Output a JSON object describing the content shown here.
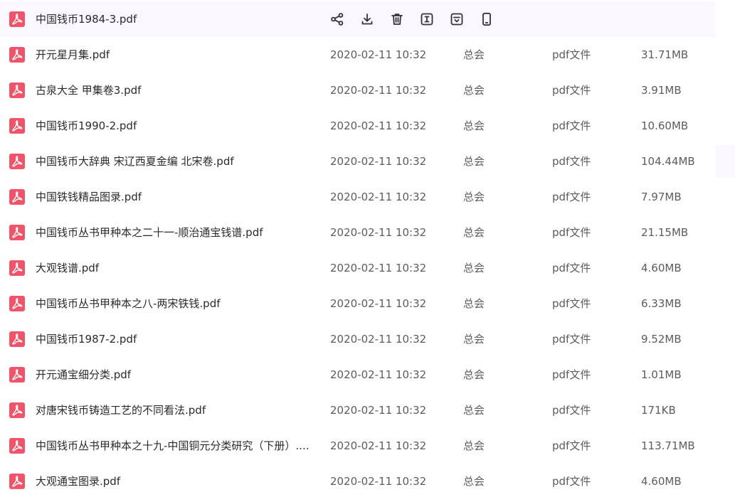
{
  "row_actions": [
    {
      "name": "share-icon",
      "label": "share"
    },
    {
      "name": "download-icon",
      "label": "download"
    },
    {
      "name": "delete-icon",
      "label": "delete"
    },
    {
      "name": "rename-icon",
      "label": "rename"
    },
    {
      "name": "move-icon",
      "label": "move"
    },
    {
      "name": "phone-icon",
      "label": "send to phone"
    }
  ],
  "colors": {
    "pdf_icon": "#f0546a",
    "hover_row": "#fbf7fe",
    "action_icon": "#333333",
    "text_primary": "#2b2b2b",
    "text_secondary": "#5c5c5c"
  },
  "files": [
    {
      "name": "中国钱币1984-3.pdf",
      "date": "",
      "owner": "",
      "type": "",
      "size": "",
      "hovered": true
    },
    {
      "name": "开元星月集.pdf",
      "date": "2020-02-11 10:32",
      "owner": "总会",
      "type": "pdf文件",
      "size": "31.71MB"
    },
    {
      "name": "古泉大全 甲集卷3.pdf",
      "date": "2020-02-11 10:32",
      "owner": "总会",
      "type": "pdf文件",
      "size": "3.91MB"
    },
    {
      "name": "中国钱币1990-2.pdf",
      "date": "2020-02-11 10:32",
      "owner": "总会",
      "type": "pdf文件",
      "size": "10.60MB"
    },
    {
      "name": "中国钱币大辞典  宋辽西夏金编  北宋卷.pdf",
      "date": "2020-02-11 10:32",
      "owner": "总会",
      "type": "pdf文件",
      "size": "104.44MB"
    },
    {
      "name": "中国铁钱精品图录.pdf",
      "date": "2020-02-11 10:32",
      "owner": "总会",
      "type": "pdf文件",
      "size": "7.97MB"
    },
    {
      "name": "中国钱币丛书甲种本之二十一-顺治通宝钱谱.pdf",
      "date": "2020-02-11 10:32",
      "owner": "总会",
      "type": "pdf文件",
      "size": "21.15MB"
    },
    {
      "name": "大观钱谱.pdf",
      "date": "2020-02-11 10:32",
      "owner": "总会",
      "type": "pdf文件",
      "size": "4.60MB"
    },
    {
      "name": "中国钱币丛书甲种本之八-两宋铁钱.pdf",
      "date": "2020-02-11 10:32",
      "owner": "总会",
      "type": "pdf文件",
      "size": "6.33MB"
    },
    {
      "name": "中国钱币1987-2.pdf",
      "date": "2020-02-11 10:32",
      "owner": "总会",
      "type": "pdf文件",
      "size": "9.52MB"
    },
    {
      "name": "开元通宝细分类.pdf",
      "date": "2020-02-11 10:32",
      "owner": "总会",
      "type": "pdf文件",
      "size": "1.01MB"
    },
    {
      "name": "对唐宋钱币铸造工艺的不同看法.pdf",
      "date": "2020-02-11 10:32",
      "owner": "总会",
      "type": "pdf文件",
      "size": "171KB"
    },
    {
      "name": "中国钱币丛书甲种本之十九-中国铜元分类研究（下册）....",
      "date": "2020-02-11 10:32",
      "owner": "总会",
      "type": "pdf文件",
      "size": "113.71MB"
    },
    {
      "name": "大观通宝图录.pdf",
      "date": "2020-02-11 10:32",
      "owner": "总会",
      "type": "pdf文件",
      "size": "4.60MB"
    }
  ]
}
